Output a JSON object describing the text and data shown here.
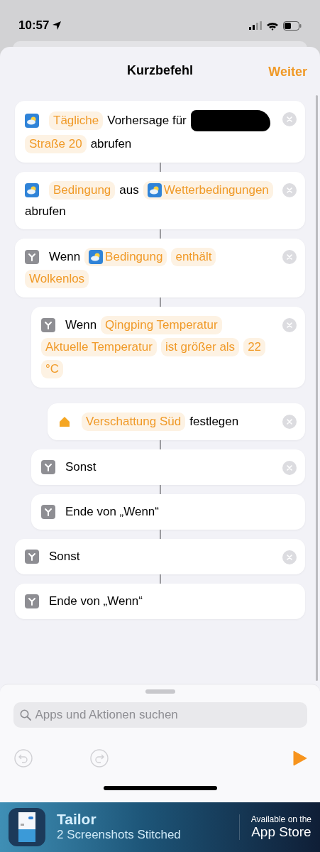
{
  "status_bar": {
    "time": "10:57"
  },
  "header": {
    "title": "Kurzbefehl",
    "action": "Weiter"
  },
  "actions": [
    {
      "kind": "weather",
      "removable": true,
      "parts": [
        {
          "kind": "variable",
          "text": "Tägliche"
        },
        {
          "kind": "text",
          "text": "Vorhersage für"
        },
        {
          "kind": "redacted"
        },
        {
          "kind": "variable",
          "text": "Straße 20"
        },
        {
          "kind": "text",
          "text": "abrufen"
        }
      ]
    },
    {
      "kind": "weather",
      "removable": true,
      "parts": [
        {
          "kind": "variable",
          "text": "Bedingung"
        },
        {
          "kind": "text",
          "text": "aus"
        },
        {
          "kind": "weather_variable",
          "text": "Wetterbedingungen"
        },
        {
          "kind": "text",
          "text": "abrufen"
        }
      ]
    },
    {
      "kind": "branch",
      "removable": true,
      "parts": [
        {
          "kind": "text",
          "text": "Wenn"
        },
        {
          "kind": "weather_variable",
          "text": "Bedingung"
        },
        {
          "kind": "variable",
          "text": "enthält"
        },
        {
          "kind": "variable",
          "text": "Wolkenlos"
        }
      ],
      "children": [
        {
          "kind": "branch",
          "removable": true,
          "parts": [
            {
              "kind": "text",
              "text": "Wenn"
            },
            {
              "kind": "variable",
              "text": "Qingping Temperatur"
            },
            {
              "kind": "variable",
              "text": "Aktuelle Temperatur"
            },
            {
              "kind": "variable",
              "text": "ist größer als"
            },
            {
              "kind": "variable",
              "text": "22"
            },
            {
              "kind": "variable",
              "text": "°C"
            }
          ],
          "children": [
            {
              "kind": "home",
              "removable": true,
              "parts": [
                {
                  "kind": "variable",
                  "text": "Verschattung Süd"
                },
                {
                  "kind": "text",
                  "text": "festlegen"
                }
              ]
            }
          ]
        },
        {
          "kind": "branch",
          "removable": true,
          "parts": [
            {
              "kind": "text",
              "text": "Sonst"
            }
          ]
        },
        {
          "kind": "branch",
          "removable": false,
          "parts": [
            {
              "kind": "text",
              "text": "Ende von „Wenn“"
            }
          ]
        }
      ]
    },
    {
      "kind": "branch",
      "removable": true,
      "parts": [
        {
          "kind": "text",
          "text": "Sonst"
        }
      ]
    },
    {
      "kind": "branch",
      "removable": false,
      "parts": [
        {
          "kind": "text",
          "text": "Ende von „Wenn“"
        }
      ]
    }
  ],
  "search": {
    "placeholder": "Apps und Aktionen suchen"
  },
  "banner": {
    "title": "Tailor",
    "subtitle": "2 Screenshots Stitched",
    "caption": "Available on the",
    "store": "App Store"
  }
}
